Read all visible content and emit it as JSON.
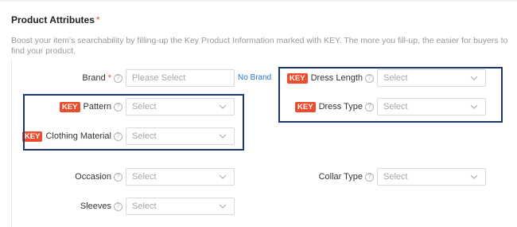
{
  "section": {
    "title": "Product Attributes",
    "required_mark": "*"
  },
  "description": "Boost your item's searchability by filling-up the Key Product Information marked with KEY. The more you fill-up, the easier for buyers to find your product.",
  "key_badge": "KEY",
  "help_glyph": "?",
  "colors": {
    "accent": "#ee4d2d",
    "link": "#2673dd",
    "highlight_border": "#1b3a6b"
  },
  "brand": {
    "label": "Brand",
    "required_mark": "*",
    "placeholder": "Please Select",
    "no_brand_link": "No Brand"
  },
  "dress_length": {
    "label": "Dress Length",
    "value": "Select"
  },
  "dress_type": {
    "label": "Dress Type",
    "value": "Select"
  },
  "pattern": {
    "label": "Pattern",
    "value": "Select"
  },
  "clothing_material": {
    "label": "Clothing Material",
    "value": "Select"
  },
  "occasion": {
    "label": "Occasion",
    "value": "Select"
  },
  "collar_type": {
    "label": "Collar Type",
    "value": "Select"
  },
  "sleeves": {
    "label": "Sleeves",
    "value": "Select"
  }
}
